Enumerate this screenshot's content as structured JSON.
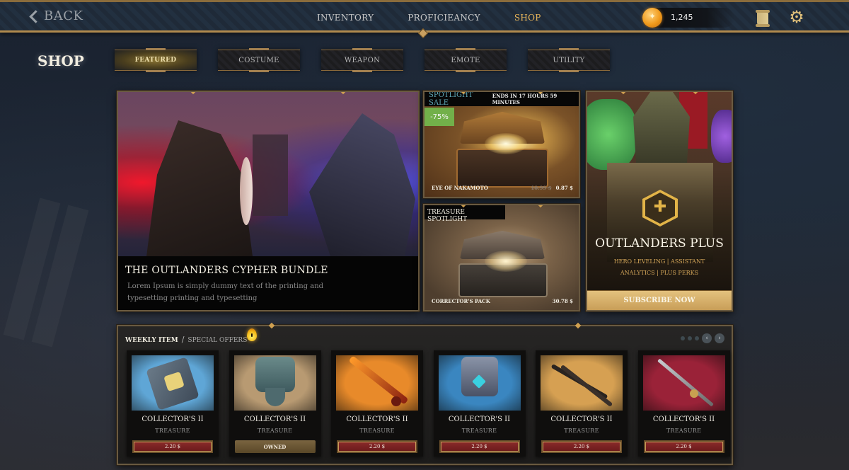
{
  "topbar": {
    "back_label": "BACK",
    "nav": [
      {
        "label": "INVENTORY",
        "active": false
      },
      {
        "label": "PROFICIEANCY",
        "active": false
      },
      {
        "label": "SHOP",
        "active": true
      }
    ],
    "currency": {
      "icon": "coin-icon",
      "value": "1,245"
    },
    "icons": [
      "scroll-icon",
      "gear-icon"
    ]
  },
  "shop": {
    "title": "SHOP",
    "tabs": [
      {
        "label": "FEATURED",
        "active": true
      },
      {
        "label": "COSTUME",
        "active": false
      },
      {
        "label": "WEAPON",
        "active": false
      },
      {
        "label": "EMOTE",
        "active": false
      },
      {
        "label": "UTILITY",
        "active": false
      }
    ]
  },
  "hero": {
    "title": "THE OUTLANDERS CYPHER BUNDLE",
    "description": "Lorem Ipsum is simply dummy text of the printing and typesetting printing and typesetting"
  },
  "spotlight_sale": {
    "tag": "SPOTLIGHT SALE",
    "timer": "ENDS IN 17 HOURS 59 MINUTES",
    "discount": "-75%",
    "name": "EYE OF NAKAMOTO",
    "old_price": "10.99 $",
    "price": "0.87 $"
  },
  "treasure_spotlight": {
    "tag": "TREASURE SPOTLIGHT",
    "name": "CORRECTOR'S PACK",
    "price": "30.78 $"
  },
  "outlanders_plus": {
    "title": "OUTLANDERS PLUS",
    "perks": "HERO LEVELING | ASSISTANT ANALYTICS | PLUS PERKS",
    "button_label": "SUBSCRIBE NOW",
    "accent": "#e2b448"
  },
  "weekly": {
    "title": "WEEKLY ITEM",
    "separator": "/",
    "subtitle": "SPECIAL OFFERS",
    "pager": {
      "dots": 3,
      "prev": "‹",
      "next": "›"
    },
    "items": [
      {
        "name": "COLLECTOR'S II",
        "type": "TREASURE",
        "button": "2.20 $",
        "owned": false,
        "bg": "#5fa6d6",
        "art": "book"
      },
      {
        "name": "COLLECTOR'S II",
        "type": "TREASURE",
        "button": "OWNED",
        "owned": true,
        "bg": "#b89a72",
        "art": "armor"
      },
      {
        "name": "COLLECTOR'S II",
        "type": "TREASURE",
        "button": "2.20 $",
        "owned": false,
        "bg": "#e88a2a",
        "art": "sword-flame"
      },
      {
        "name": "COLLECTOR'S II",
        "type": "TREASURE",
        "button": "2.20 $",
        "owned": false,
        "bg": "#3a86c0",
        "art": "chestplate"
      },
      {
        "name": "COLLECTOR'S II",
        "type": "TREASURE",
        "button": "2.20 $",
        "owned": false,
        "bg": "#d6a052",
        "art": "daggers"
      },
      {
        "name": "COLLECTOR'S II",
        "type": "TREASURE",
        "button": "2.20 $",
        "owned": false,
        "bg": "#9a2238",
        "art": "longsword"
      }
    ]
  },
  "colors": {
    "gold_accent": "#e8b55a",
    "frame": "#6a5a40",
    "price_button": "#8a2a2a",
    "discount_green": "#72b04a",
    "sale_tag": "#5fa8b8"
  }
}
